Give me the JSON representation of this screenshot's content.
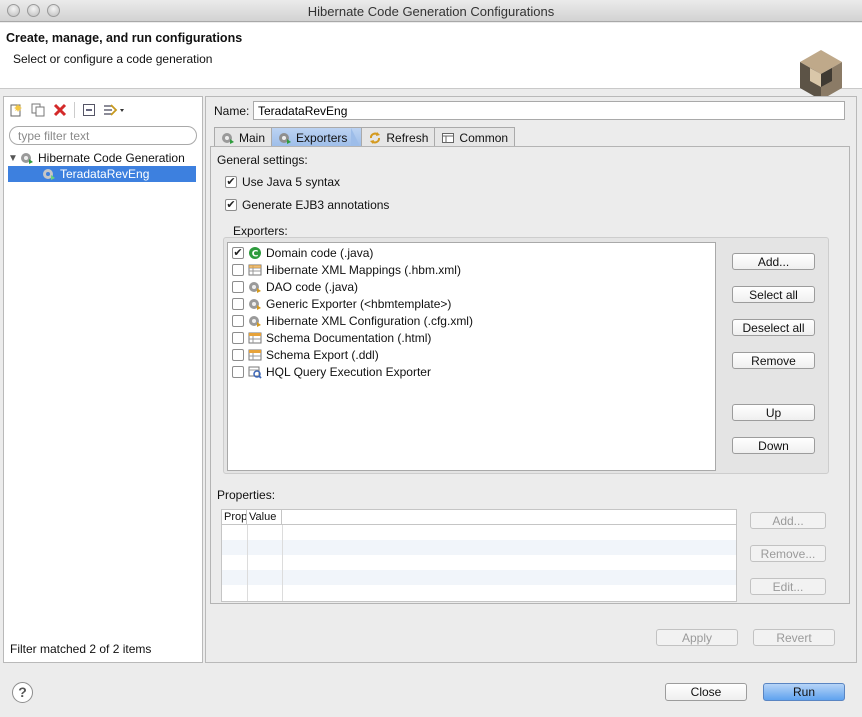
{
  "window": {
    "title": "Hibernate Code Generation Configurations"
  },
  "header": {
    "title": "Create, manage, and run configurations",
    "subtitle": "Select or configure a code generation"
  },
  "left": {
    "filter_placeholder": "type filter text",
    "tree": {
      "root": "Hibernate Code Generation",
      "child": "TeradataRevEng"
    },
    "status": "Filter matched 2 of 2 items"
  },
  "config": {
    "name_label": "Name:",
    "name_value": "TeradataRevEng",
    "tabs": [
      {
        "label": "Main"
      },
      {
        "label": "Exporters"
      },
      {
        "label": "Refresh"
      },
      {
        "label": "Common"
      }
    ],
    "general_settings": "General settings:",
    "use_java5": "Use Java 5 syntax",
    "ejb3": "Generate EJB3 annotations",
    "exporters_label": "Exporters:",
    "exporters": [
      {
        "label": "Domain code (.java)",
        "checked": true
      },
      {
        "label": "Hibernate XML Mappings (.hbm.xml)",
        "checked": false
      },
      {
        "label": "DAO code (.java)",
        "checked": false
      },
      {
        "label": "Generic Exporter (<hbmtemplate>)",
        "checked": false
      },
      {
        "label": "Hibernate XML Configuration (.cfg.xml)",
        "checked": false
      },
      {
        "label": "Schema Documentation (.html)",
        "checked": false
      },
      {
        "label": "Schema Export (.ddl)",
        "checked": false
      },
      {
        "label": "HQL Query Execution Exporter",
        "checked": false
      }
    ],
    "exporter_buttons": {
      "add": "Add...",
      "select_all": "Select all",
      "deselect_all": "Deselect all",
      "remove": "Remove",
      "up": "Up",
      "down": "Down"
    },
    "properties_label": "Properties:",
    "properties_columns": {
      "prop": "Prop",
      "value": "Value"
    },
    "properties_buttons": {
      "add": "Add...",
      "remove": "Remove...",
      "edit": "Edit..."
    },
    "apply": "Apply",
    "revert": "Revert"
  },
  "footer": {
    "help": "?",
    "close": "Close",
    "run": "Run"
  },
  "colors": {
    "selection": "#3d80df",
    "active_tab": "#9dbde9",
    "domain_code_badge": "#2e9b3d"
  }
}
